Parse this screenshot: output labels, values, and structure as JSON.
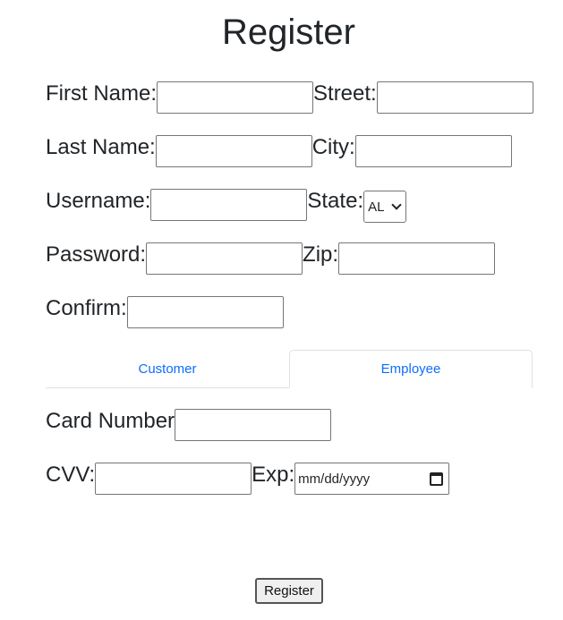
{
  "title": "Register",
  "fields": {
    "first_name": {
      "label": "First Name:",
      "value": ""
    },
    "last_name": {
      "label": "Last Name:",
      "value": ""
    },
    "username": {
      "label": "Username:",
      "value": ""
    },
    "password": {
      "label": "Password:",
      "value": ""
    },
    "confirm": {
      "label": "Confirm:",
      "value": ""
    },
    "street": {
      "label": "Street:",
      "value": ""
    },
    "city": {
      "label": "City:",
      "value": ""
    },
    "state": {
      "label": "State:",
      "selected": "AL"
    },
    "zip": {
      "label": "Zip:",
      "value": ""
    }
  },
  "tabs": [
    {
      "label": "Customer",
      "active": false
    },
    {
      "label": "Employee",
      "active": true
    }
  ],
  "payment": {
    "card_number": {
      "label": "Card Number",
      "value": ""
    },
    "cvv": {
      "label": "CVV:",
      "value": ""
    },
    "exp": {
      "label": "Exp:",
      "placeholder": "mm/dd/yyyy"
    }
  },
  "submit_label": "Register",
  "icons": {
    "select_arrow": "chevron-down-icon",
    "date_picker": "calendar-icon"
  },
  "colors": {
    "tab_text": "#0d6efd",
    "tab_border": "#dee2e6",
    "text": "#212529"
  }
}
